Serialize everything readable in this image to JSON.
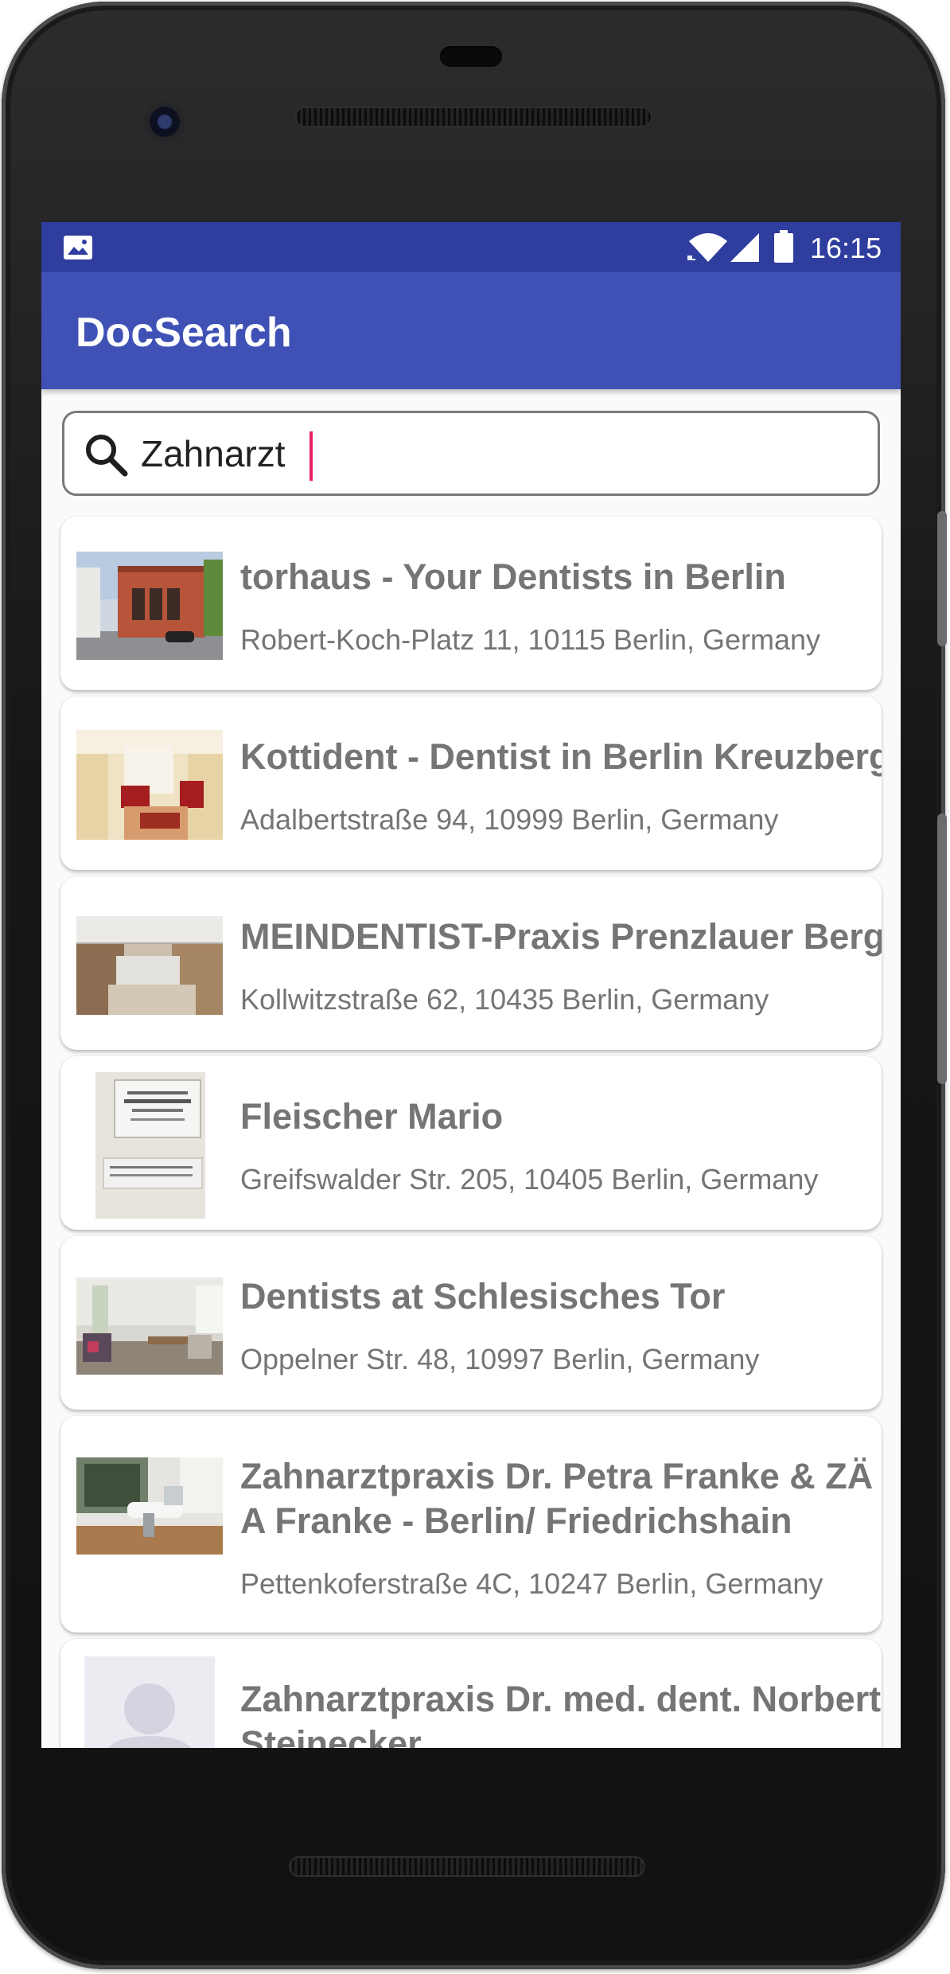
{
  "status_bar": {
    "time": "16:15",
    "icons": [
      "image-icon",
      "wifi-icon",
      "signal-icon",
      "battery-icon"
    ]
  },
  "app_bar": {
    "title": "DocSearch"
  },
  "search": {
    "value": "Zahnarzt",
    "icon": "search-icon"
  },
  "results": [
    {
      "name": "torhaus - Your Dentists in Berlin",
      "address": "Robert-Koch-Platz 11, 10115 Berlin, Germany"
    },
    {
      "name": "Kottident - Dentist in Berlin Kreuzberg",
      "address": "Adalbertstraße 94, 10999 Berlin, Germany"
    },
    {
      "name": "MEINDENTIST-Praxis Prenzlauer Berg",
      "address": "Kollwitzstraße 62, 10435 Berlin, Germany"
    },
    {
      "name": "Fleischer Mario",
      "address": "Greifswalder Str. 205, 10405 Berlin, Germany"
    },
    {
      "name": "Dentists at Schlesisches Tor",
      "address": "Oppelner Str. 48, 10997 Berlin, Germany"
    },
    {
      "name": "Zahnarztpraxis Dr. Petra Franke & ZÄ A Franke - Berlin/ Friedrichshain",
      "address": "Pettenkoferstraße 4C, 10247 Berlin, Germany"
    },
    {
      "name": "Zahnarztpraxis Dr. med. dent. Norbert Steinecker",
      "address": ""
    }
  ],
  "colors": {
    "status_bar": "#2f3e9e",
    "app_bar": "#3f51b5",
    "caret": "#e91e63",
    "card_text": "#757575"
  }
}
